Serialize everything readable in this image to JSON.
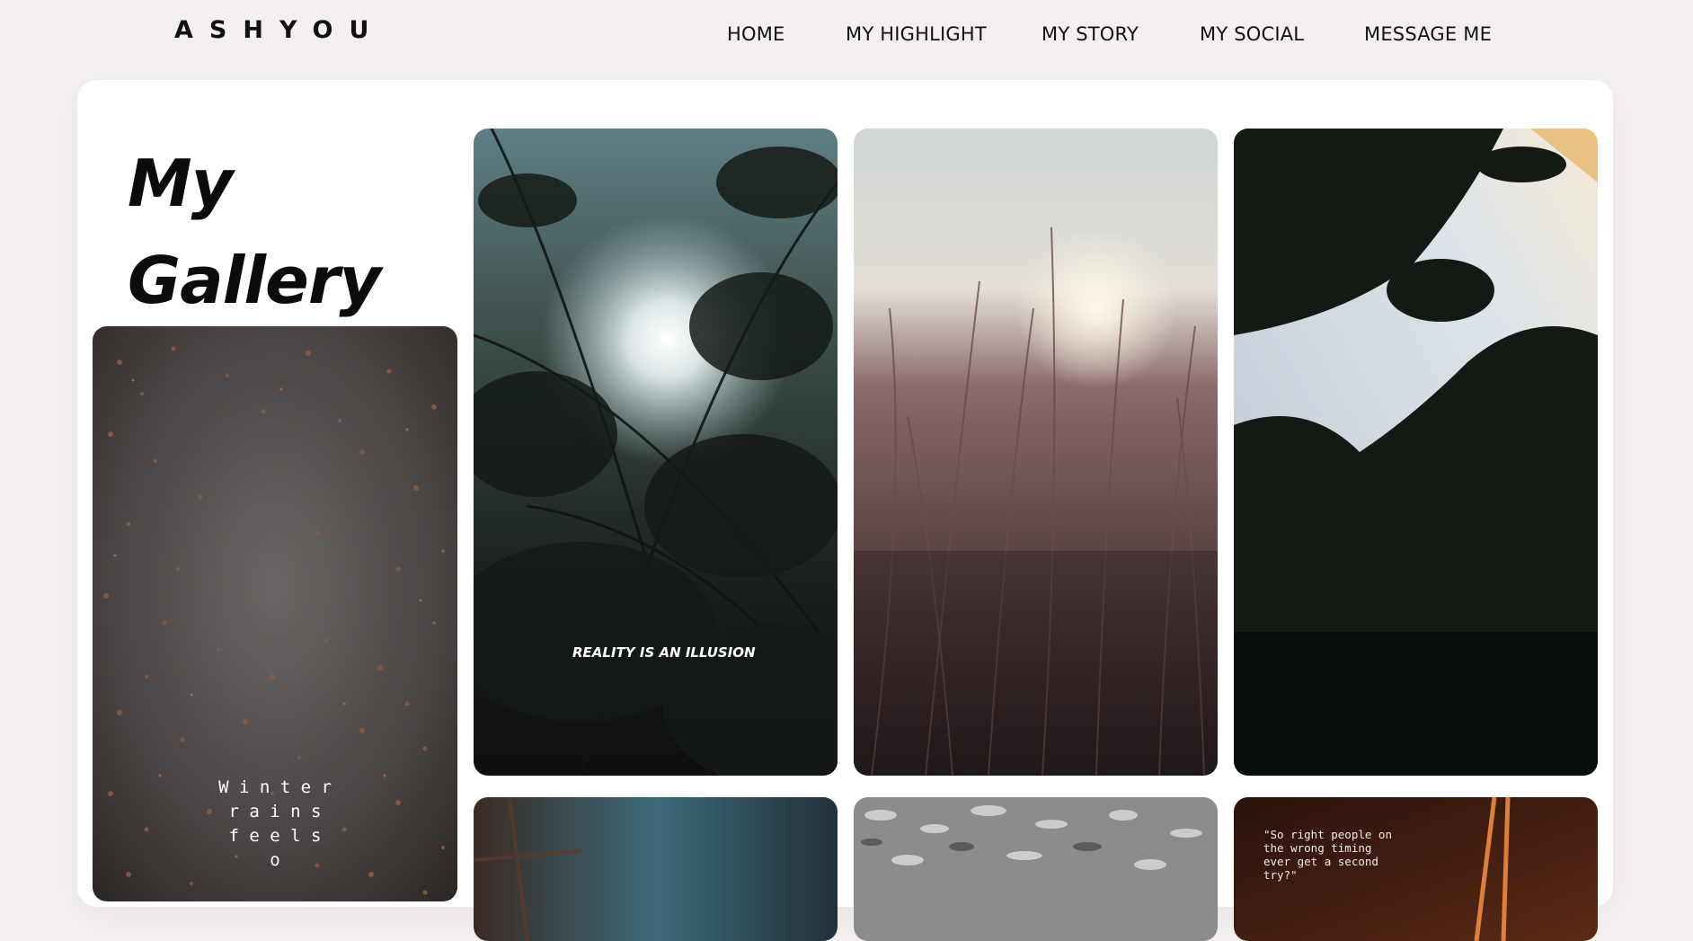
{
  "brand": {
    "name": "ASHYOU"
  },
  "nav": {
    "items": [
      {
        "label": "HOME"
      },
      {
        "label": "MY HIGHLIGHT"
      },
      {
        "label": "MY STORY"
      },
      {
        "label": "MY SOCIAL"
      },
      {
        "label": "MESSAGE ME"
      }
    ]
  },
  "gallery": {
    "title_line1": "My",
    "title_line2": "Gallery",
    "photos": [
      {
        "caption_lines": [
          "W i n t e r",
          "r a i n s",
          "f e e l s",
          "o"
        ]
      },
      {
        "caption": "REALITY IS AN ILLUSION"
      },
      {
        "caption": ""
      },
      {
        "caption": ""
      },
      {
        "caption": ""
      },
      {
        "caption": ""
      },
      {
        "caption_lines": [
          "\"So right people on",
          "the wrong timing",
          "ever get a second",
          "try?\""
        ]
      }
    ]
  }
}
